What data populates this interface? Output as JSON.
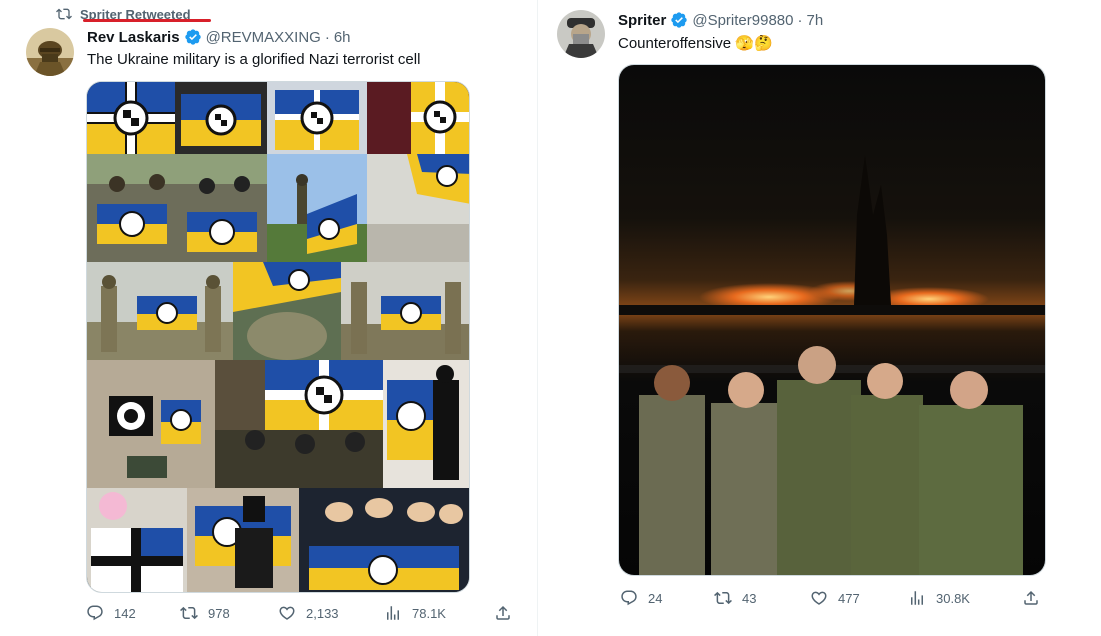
{
  "left_tweet": {
    "retweet_label": "Spriter Retweeted",
    "author_name": "Rev Laskaris",
    "handle": "@REVMAXXING",
    "separator": "·",
    "time": "6h",
    "text": "The Ukraine military is a glorified Nazi terrorist cell",
    "stats": {
      "replies": "142",
      "retweets": "978",
      "likes": "2,133",
      "views": "78.1K"
    }
  },
  "right_tweet": {
    "author_name": "Spriter",
    "handle": "@Spriter99880",
    "separator": "·",
    "time": "7h",
    "text": "Counteroffensive 🫣🤔",
    "stats": {
      "replies": "24",
      "retweets": "43",
      "likes": "477",
      "views": "30.8K"
    }
  },
  "colors": {
    "verified": "#1d9bf0",
    "secondary_text": "#536471",
    "annotation_underline": "#d8202a",
    "flag_blue": "#1f4fa8",
    "flag_yellow": "#f2c523"
  },
  "icons": {
    "retweet": "retweet-icon",
    "reply": "reply-icon",
    "like": "heart-icon",
    "views": "views-chart-icon",
    "share": "share-icon",
    "verified": "verified-badge-icon"
  }
}
